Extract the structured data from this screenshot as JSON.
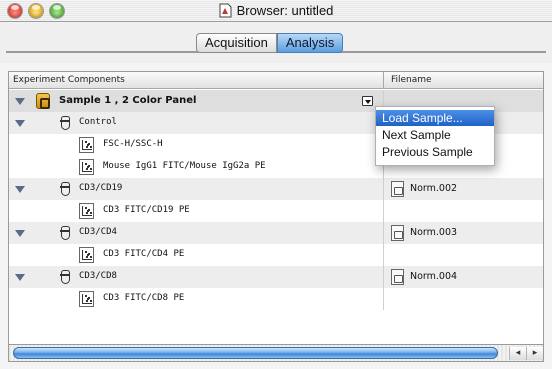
{
  "window": {
    "title": "Browser: untitled"
  },
  "tabs": [
    {
      "label": "Acquisition",
      "selected": false
    },
    {
      "label": "Analysis",
      "selected": true
    }
  ],
  "table": {
    "headers": {
      "components": "Experiment Components",
      "filename": "Filename"
    },
    "rows": [
      {
        "label": "Sample 1 , 2 Color Panel",
        "kind": "panel",
        "icon": "sample-bag-icon",
        "expanded": true
      },
      {
        "label": "Control",
        "kind": "tube",
        "icon": "tube-icon",
        "expanded": true,
        "filename": ""
      },
      {
        "label": "FSC-H/SSC-H",
        "kind": "plot",
        "icon": "dot-plot-icon"
      },
      {
        "label": "Mouse IgG1 FITC/Mouse IgG2a PE",
        "kind": "plot",
        "icon": "dot-plot-icon"
      },
      {
        "label": "CD3/CD19",
        "kind": "tube",
        "icon": "tube-icon",
        "expanded": true,
        "filename": "Norm.002"
      },
      {
        "label": "CD3 FITC/CD19 PE",
        "kind": "plot",
        "icon": "dot-plot-icon"
      },
      {
        "label": "CD3/CD4",
        "kind": "tube",
        "icon": "tube-icon",
        "expanded": true,
        "filename": "Norm.003"
      },
      {
        "label": "CD3 FITC/CD4 PE",
        "kind": "plot",
        "icon": "dot-plot-icon"
      },
      {
        "label": "CD3/CD8",
        "kind": "tube",
        "icon": "tube-icon",
        "expanded": true,
        "filename": "Norm.004"
      },
      {
        "label": "CD3 FITC/CD8 PE",
        "kind": "plot",
        "icon": "dot-plot-icon"
      }
    ]
  },
  "popup_menu": {
    "items": [
      "Load Sample...",
      "Next Sample",
      "Previous Sample"
    ],
    "highlighted": "Load Sample..."
  },
  "colors": {
    "accent": "#3f86d9",
    "selection": "#1f62c7"
  }
}
